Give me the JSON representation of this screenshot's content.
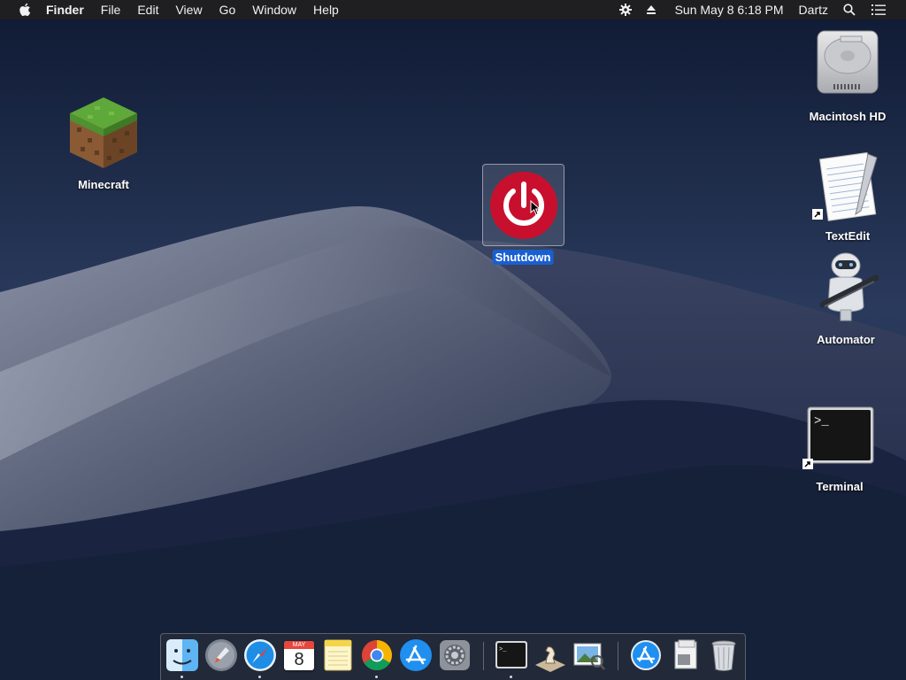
{
  "menubar": {
    "app_name": "Finder",
    "menus": [
      "File",
      "Edit",
      "View",
      "Go",
      "Window",
      "Help"
    ],
    "status_icons": [
      "gear-icon",
      "eject-icon"
    ],
    "clock": "Sun May 8  6:18 PM",
    "user": "Dartz"
  },
  "desktop": {
    "icons": [
      {
        "label": "Minecraft",
        "icon": "minecraft-block-icon"
      },
      {
        "label": "Shutdown",
        "icon": "power-icon",
        "selected": true
      },
      {
        "label": "Macintosh HD",
        "icon": "hard-drive-icon"
      },
      {
        "label": "TextEdit",
        "icon": "textedit-icon",
        "alias": true
      },
      {
        "label": "Automator",
        "icon": "automator-robot-icon"
      },
      {
        "label": "Terminal",
        "icon": "terminal-icon",
        "alias": true
      }
    ]
  },
  "dock": {
    "calendar_month": "MAY",
    "calendar_day": "8",
    "items": [
      {
        "app": "Finder",
        "icon": "finder-icon",
        "running": true
      },
      {
        "app": "Launchpad",
        "icon": "launchpad-icon",
        "running": false
      },
      {
        "app": "Safari",
        "icon": "safari-icon",
        "running": true
      },
      {
        "app": "Calendar",
        "icon": "calendar-icon",
        "running": false
      },
      {
        "app": "Notes",
        "icon": "notes-icon",
        "running": false
      },
      {
        "app": "Chrome",
        "icon": "chrome-icon",
        "running": true
      },
      {
        "app": "App Store",
        "icon": "app-store-icon",
        "running": false
      },
      {
        "app": "System Preferences",
        "icon": "system-preferences-icon",
        "running": false
      },
      {
        "app": "Terminal",
        "icon": "terminal-icon",
        "running": true
      },
      {
        "app": "Chess",
        "icon": "chess-icon",
        "running": false
      },
      {
        "app": "Preview",
        "icon": "preview-icon",
        "running": false
      },
      {
        "app": "Downloads",
        "icon": "app-store-folder-icon",
        "running": false
      },
      {
        "app": "Documents",
        "icon": "documents-stack-icon",
        "running": false
      },
      {
        "app": "Trash",
        "icon": "trash-icon",
        "running": false
      }
    ]
  },
  "colors": {
    "menubar_bg": "#1f1f22",
    "selection_blue": "#1a5fd1",
    "power_red": "#c8102e",
    "wallpaper_sky": "#1c2a47"
  }
}
